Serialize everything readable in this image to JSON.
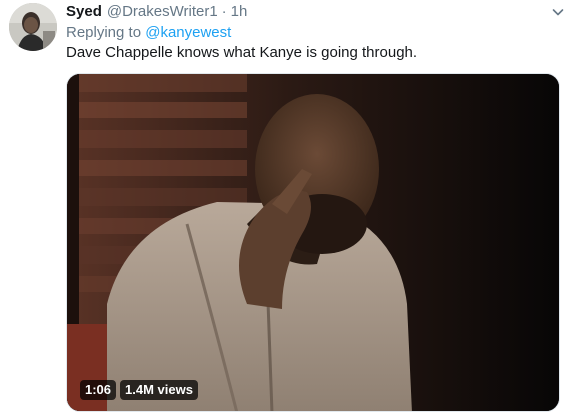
{
  "tweet": {
    "author_name": "Syed",
    "author_handle": "@DrakesWriter1",
    "separator": "·",
    "timestamp": "1h",
    "reply_prefix": "Replying to",
    "reply_mention": "@kanyewest",
    "text": "Dave Chappelle knows what Kanye is going through.",
    "avatar_icon": "user-avatar",
    "menu_icon": "chevron-down-icon"
  },
  "media": {
    "duration": "1:06",
    "views": "1.4M views"
  },
  "colors": {
    "link": "#1da1f2",
    "secondary_text": "#657786",
    "primary_text": "#14171a"
  }
}
